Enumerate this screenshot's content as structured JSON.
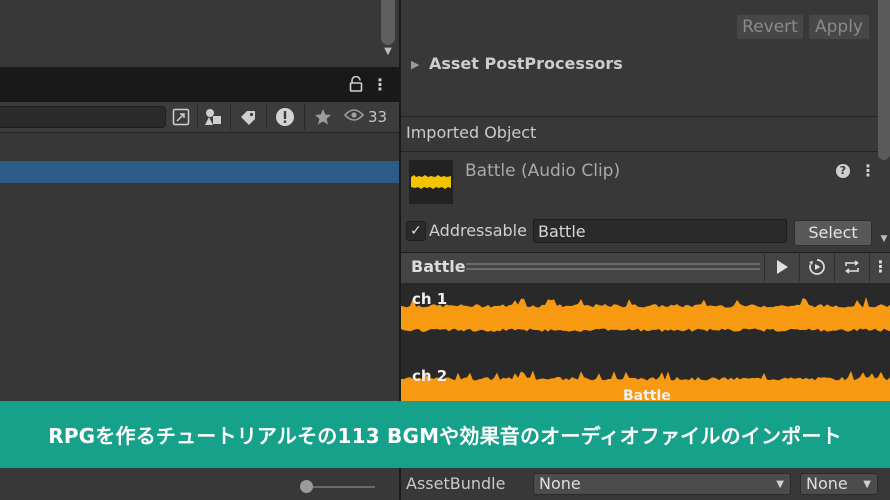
{
  "toolbar": {
    "eye_count": "33"
  },
  "import_settings": {
    "revert_label": "Revert",
    "apply_label": "Apply"
  },
  "asset_postprocessors": {
    "label": "Asset PostProcessors"
  },
  "imported_object": {
    "section_label": "Imported Object",
    "title": "Battle (Audio Clip)",
    "addressable_label": "Addressable",
    "addressable_checked": true,
    "address_value": "Battle",
    "select_label": "Select"
  },
  "preview": {
    "title": "Battle",
    "channels": [
      "ch 1",
      "ch 2"
    ],
    "overlay_label": "Battle",
    "waveform_color": "#f79a12"
  },
  "banner": {
    "text": "RPGを作るチュートリアルその113 BGMや効果音のオーディオファイルのインポート",
    "color": "#16a18a"
  },
  "asset_bundle": {
    "label": "AssetBundle",
    "name_value": "None",
    "variant_value": "None"
  },
  "colors": {
    "selection": "#2c5d87",
    "accent_orange": "#f79a12"
  }
}
